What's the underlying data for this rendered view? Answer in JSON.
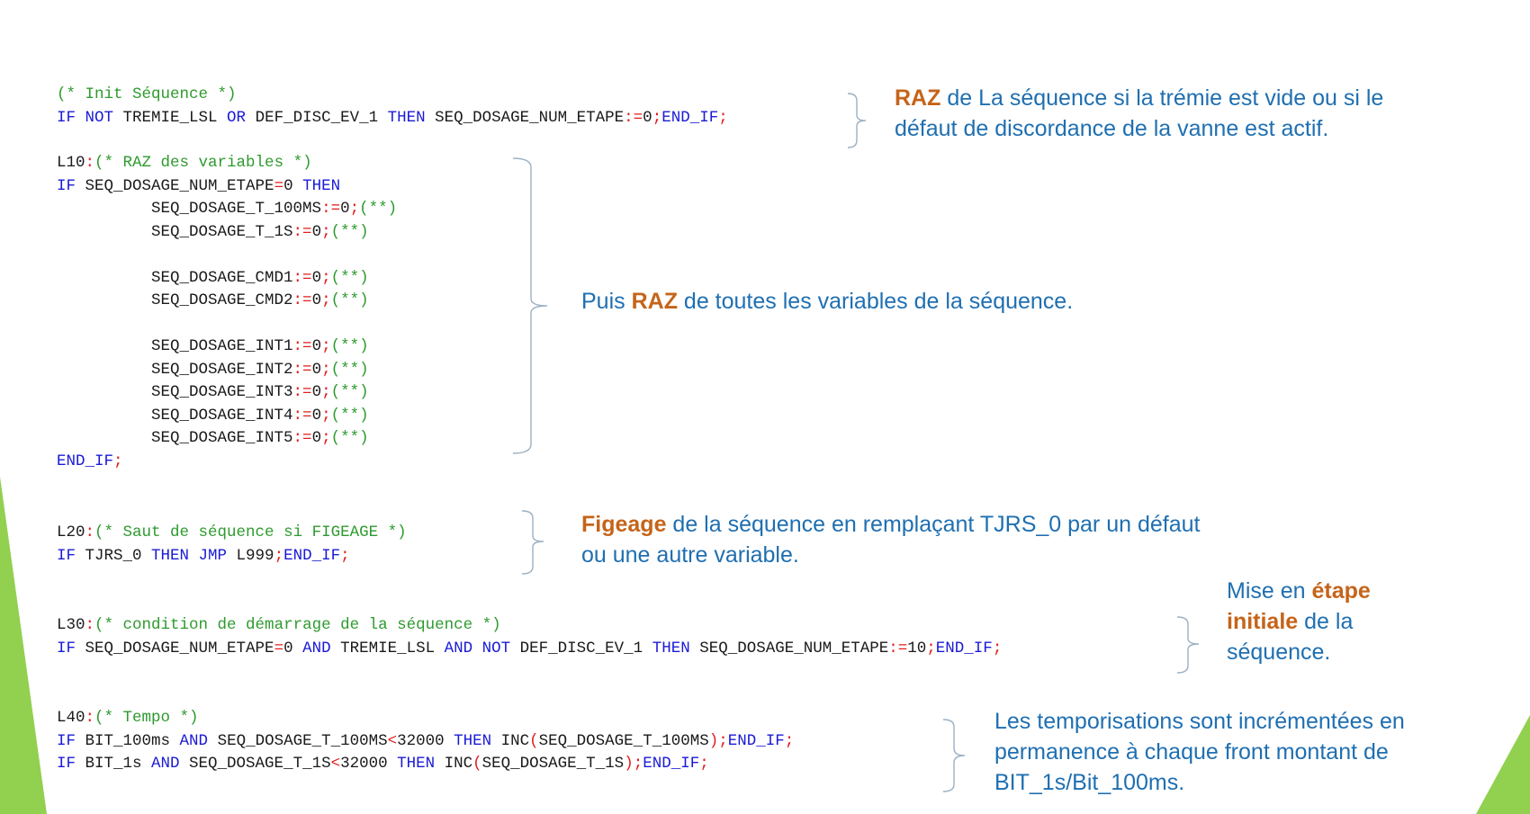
{
  "code_blocks": [
    {
      "lines": [
        [
          [
            "cm",
            "(* Init Séquence *)"
          ]
        ],
        [
          [
            "kw",
            "IF NOT "
          ],
          [
            "tx",
            "TREMIE_LSL "
          ],
          [
            "kw",
            "OR "
          ],
          [
            "tx",
            "DEF_DISC_EV_1 "
          ],
          [
            "kw",
            "THEN "
          ],
          [
            "tx",
            "SEQ_DOSAGE_NUM_ETAPE"
          ],
          [
            "op",
            ":="
          ],
          [
            "tx",
            "0"
          ],
          [
            "op",
            ";"
          ],
          [
            "kw",
            "END_IF"
          ],
          [
            "op",
            ";"
          ]
        ]
      ]
    },
    {
      "lines": [
        [
          [
            "tx",
            "L10"
          ],
          [
            "op",
            ":"
          ],
          [
            "cm",
            "(* RAZ des variables *)"
          ]
        ],
        [
          [
            "kw",
            "IF "
          ],
          [
            "tx",
            "SEQ_DOSAGE_NUM_ETAPE"
          ],
          [
            "op",
            "="
          ],
          [
            "tx",
            "0 "
          ],
          [
            "kw",
            "THEN"
          ]
        ],
        [
          [
            "tx",
            "          SEQ_DOSAGE_T_100MS"
          ],
          [
            "op",
            ":="
          ],
          [
            "tx",
            "0"
          ],
          [
            "op",
            ";"
          ],
          [
            "cm",
            "(**)"
          ]
        ],
        [
          [
            "tx",
            "          SEQ_DOSAGE_T_1S"
          ],
          [
            "op",
            ":="
          ],
          [
            "tx",
            "0"
          ],
          [
            "op",
            ";"
          ],
          [
            "cm",
            "(**)"
          ]
        ],
        [],
        [
          [
            "tx",
            "          SEQ_DOSAGE_CMD1"
          ],
          [
            "op",
            ":="
          ],
          [
            "tx",
            "0"
          ],
          [
            "op",
            ";"
          ],
          [
            "cm",
            "(**)"
          ]
        ],
        [
          [
            "tx",
            "          SEQ_DOSAGE_CMD2"
          ],
          [
            "op",
            ":="
          ],
          [
            "tx",
            "0"
          ],
          [
            "op",
            ";"
          ],
          [
            "cm",
            "(**)"
          ]
        ],
        [],
        [
          [
            "tx",
            "          SEQ_DOSAGE_INT1"
          ],
          [
            "op",
            ":="
          ],
          [
            "tx",
            "0"
          ],
          [
            "op",
            ";"
          ],
          [
            "cm",
            "(**)"
          ]
        ],
        [
          [
            "tx",
            "          SEQ_DOSAGE_INT2"
          ],
          [
            "op",
            ":="
          ],
          [
            "tx",
            "0"
          ],
          [
            "op",
            ";"
          ],
          [
            "cm",
            "(**)"
          ]
        ],
        [
          [
            "tx",
            "          SEQ_DOSAGE_INT3"
          ],
          [
            "op",
            ":="
          ],
          [
            "tx",
            "0"
          ],
          [
            "op",
            ";"
          ],
          [
            "cm",
            "(**)"
          ]
        ],
        [
          [
            "tx",
            "          SEQ_DOSAGE_INT4"
          ],
          [
            "op",
            ":="
          ],
          [
            "tx",
            "0"
          ],
          [
            "op",
            ";"
          ],
          [
            "cm",
            "(**)"
          ]
        ],
        [
          [
            "tx",
            "          SEQ_DOSAGE_INT5"
          ],
          [
            "op",
            ":="
          ],
          [
            "tx",
            "0"
          ],
          [
            "op",
            ";"
          ],
          [
            "cm",
            "(**)"
          ]
        ],
        [
          [
            "kw",
            "END_IF"
          ],
          [
            "op",
            ";"
          ]
        ]
      ]
    },
    {
      "lines": [
        [
          [
            "tx",
            "L20"
          ],
          [
            "op",
            ":"
          ],
          [
            "cm",
            "(* Saut de séquence si FIGEAGE *)"
          ]
        ],
        [
          [
            "kw",
            "IF "
          ],
          [
            "tx",
            "TJRS_0 "
          ],
          [
            "kw",
            "THEN JMP "
          ],
          [
            "tx",
            "L999"
          ],
          [
            "op",
            ";"
          ],
          [
            "kw",
            "END_IF"
          ],
          [
            "op",
            ";"
          ]
        ]
      ]
    },
    {
      "lines": [
        [
          [
            "tx",
            "L30"
          ],
          [
            "op",
            ":"
          ],
          [
            "cm",
            "(* condition de démarrage de la séquence *)"
          ]
        ],
        [
          [
            "kw",
            "IF "
          ],
          [
            "tx",
            "SEQ_DOSAGE_NUM_ETAPE"
          ],
          [
            "op",
            "="
          ],
          [
            "tx",
            "0 "
          ],
          [
            "kw",
            "AND "
          ],
          [
            "tx",
            "TREMIE_LSL "
          ],
          [
            "kw",
            "AND NOT "
          ],
          [
            "tx",
            "DEF_DISC_EV_1 "
          ],
          [
            "kw",
            "THEN "
          ],
          [
            "tx",
            "SEQ_DOSAGE_NUM_ETAPE"
          ],
          [
            "op",
            ":="
          ],
          [
            "tx",
            "10"
          ],
          [
            "op",
            ";"
          ],
          [
            "kw",
            "END_IF"
          ],
          [
            "op",
            ";"
          ]
        ]
      ]
    },
    {
      "lines": [
        [
          [
            "tx",
            "L40"
          ],
          [
            "op",
            ":"
          ],
          [
            "cm",
            "(* Tempo *)"
          ]
        ],
        [
          [
            "kw",
            "IF "
          ],
          [
            "tx",
            "BIT_100ms "
          ],
          [
            "kw",
            "AND "
          ],
          [
            "tx",
            "SEQ_DOSAGE_T_100MS"
          ],
          [
            "op",
            "<"
          ],
          [
            "tx",
            "32000 "
          ],
          [
            "kw",
            "THEN "
          ],
          [
            "tx",
            "INC"
          ],
          [
            "op",
            "("
          ],
          [
            "tx",
            "SEQ_DOSAGE_T_100MS"
          ],
          [
            "op",
            ")"
          ],
          [
            "op",
            ";"
          ],
          [
            "kw",
            "END_IF"
          ],
          [
            "op",
            ";"
          ]
        ],
        [
          [
            "kw",
            "IF "
          ],
          [
            "tx",
            "BIT_1s "
          ],
          [
            "kw",
            "AND "
          ],
          [
            "tx",
            "SEQ_DOSAGE_T_1S"
          ],
          [
            "op",
            "<"
          ],
          [
            "tx",
            "32000 "
          ],
          [
            "kw",
            "THEN "
          ],
          [
            "tx",
            "INC"
          ],
          [
            "op",
            "("
          ],
          [
            "tx",
            "SEQ_DOSAGE_T_1S"
          ],
          [
            "op",
            ")"
          ],
          [
            "op",
            ";"
          ],
          [
            "kw",
            "END_IF"
          ],
          [
            "op",
            ";"
          ]
        ]
      ]
    }
  ],
  "notes": {
    "raz_sequence": {
      "l1_bold": "RAZ",
      "l1_rest": " de La séquence si la trémie est vide ou si le",
      "l2": "défaut de discordance de la vanne est actif."
    },
    "raz_variables": {
      "pre": "Puis ",
      "bold": "RAZ",
      "post": " de toutes les variables de la séquence."
    },
    "figeage": {
      "l1_bold": "Figeage",
      "l1_rest": " de la séquence en remplaçant  TJRS_0 par  un défaut",
      "l2": "ou une autre variable."
    },
    "etape_initiale": {
      "l1_pre": "Mise en ",
      "l1_bold": "étape",
      "l2_bold": "initiale",
      "l2_rest": " de la",
      "l3": "séquence."
    },
    "tempo": {
      "l1": "Les temporisations sont incrémentées  en",
      "l2": "permanence à chaque front montant de",
      "l3": "BIT_1s/Bit_100ms."
    }
  },
  "colors": {
    "comment": "#2e9a2e",
    "keyword": "#1b1bd6",
    "operator": "#e11d1d",
    "note_text": "#1f6fb1",
    "note_bold": "#c5641a",
    "accent_green": "#92d050"
  }
}
